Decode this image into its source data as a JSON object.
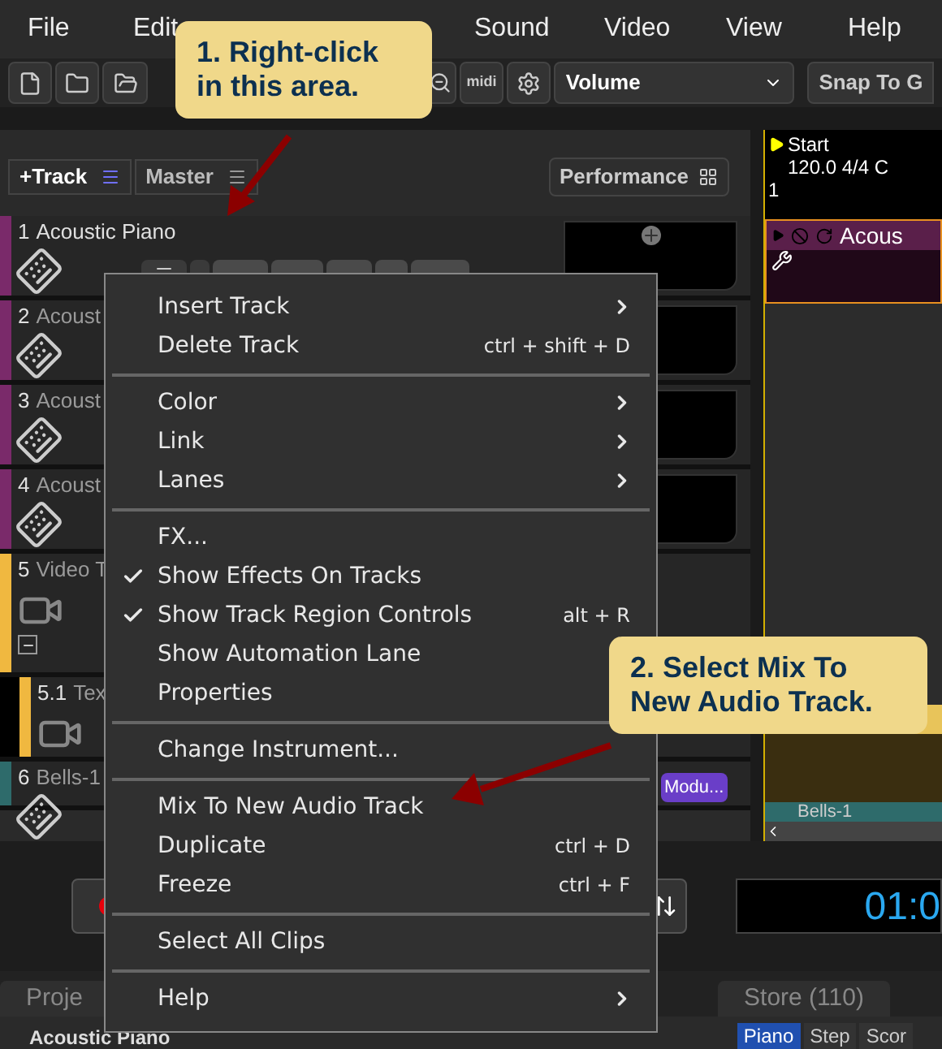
{
  "menu_bar": [
    {
      "label": "File"
    },
    {
      "label": "Edit"
    },
    {
      "label": "Sound"
    },
    {
      "label": "Video"
    },
    {
      "label": "View"
    },
    {
      "label": "Help"
    }
  ],
  "toolbar": {
    "midi_label": "midi",
    "dropdown": "Volume",
    "snap": "Snap To G"
  },
  "track_panel": {
    "add_track": "+Track",
    "master": "Master",
    "performance": "Performance"
  },
  "tracks": [
    {
      "number": "1",
      "name": "Acoustic Piano",
      "color": "#7a2a6a",
      "kind": "instrument"
    },
    {
      "number": "2",
      "name": "Acoust",
      "color": "#7a2a6a",
      "kind": "instrument"
    },
    {
      "number": "3",
      "name": "Acoust",
      "color": "#7a2a6a",
      "kind": "instrument"
    },
    {
      "number": "4",
      "name": "Acoust",
      "color": "#7a2a6a",
      "kind": "instrument"
    },
    {
      "number": "5",
      "name": "Video T",
      "color": "#f0b840",
      "kind": "video"
    },
    {
      "number": "5.1",
      "name": "Tex",
      "color": "#f0b840",
      "kind": "subvideo"
    },
    {
      "number": "6",
      "name": "Bells-1",
      "color": "#2e6b6b",
      "kind": "instrument"
    }
  ],
  "modulation_button": "Modu...",
  "timeline": {
    "marker_title": "Start",
    "marker_info": "120.0 4/4 C",
    "bar": "1",
    "clips": [
      {
        "label": "Acous",
        "color": "#5a1f4a"
      },
      {
        "label": "Bells-1",
        "color": "#2e6b6b"
      }
    ]
  },
  "transport": {
    "time": "01:0"
  },
  "tabs": [
    {
      "label": "Proje",
      "selected": false
    },
    {
      "label": "Store (110)",
      "selected": false
    }
  ],
  "bottom": {
    "title": "Acoustic Piano",
    "tabs": [
      {
        "label": "Piano",
        "selected": true
      },
      {
        "label": "Step",
        "selected": false
      },
      {
        "label": "Scor",
        "selected": false
      }
    ]
  },
  "context_menu": [
    {
      "kind": "item",
      "label": "Insert Track",
      "submenu": true
    },
    {
      "kind": "item",
      "label": "Delete Track",
      "shortcut": "ctrl + shift + D"
    },
    {
      "kind": "separator"
    },
    {
      "kind": "item",
      "label": "Color",
      "submenu": true
    },
    {
      "kind": "item",
      "label": "Link",
      "submenu": true
    },
    {
      "kind": "item",
      "label": "Lanes",
      "submenu": true
    },
    {
      "kind": "separator"
    },
    {
      "kind": "item",
      "label": "FX..."
    },
    {
      "kind": "item",
      "label": "Show Effects On Tracks",
      "checked": true
    },
    {
      "kind": "item",
      "label": "Show Track Region Controls",
      "checked": true,
      "shortcut": "alt + R"
    },
    {
      "kind": "item",
      "label": "Show Automation Lane",
      "checked": false
    },
    {
      "kind": "item",
      "label": "Properties"
    },
    {
      "kind": "separator"
    },
    {
      "kind": "item",
      "label": "Change Instrument..."
    },
    {
      "kind": "separator"
    },
    {
      "kind": "item",
      "label": "Mix To New Audio Track"
    },
    {
      "kind": "item",
      "label": "Duplicate",
      "shortcut": "ctrl + D"
    },
    {
      "kind": "item",
      "label": "Freeze",
      "shortcut": "ctrl + F"
    },
    {
      "kind": "separator"
    },
    {
      "kind": "item",
      "label": "Select All Clips"
    },
    {
      "kind": "separator"
    },
    {
      "kind": "item",
      "label": "Help",
      "submenu": true
    }
  ],
  "callouts": [
    {
      "text": "1. Right-click in this area."
    },
    {
      "text": "2. Select Mix To New Audio Track."
    }
  ]
}
